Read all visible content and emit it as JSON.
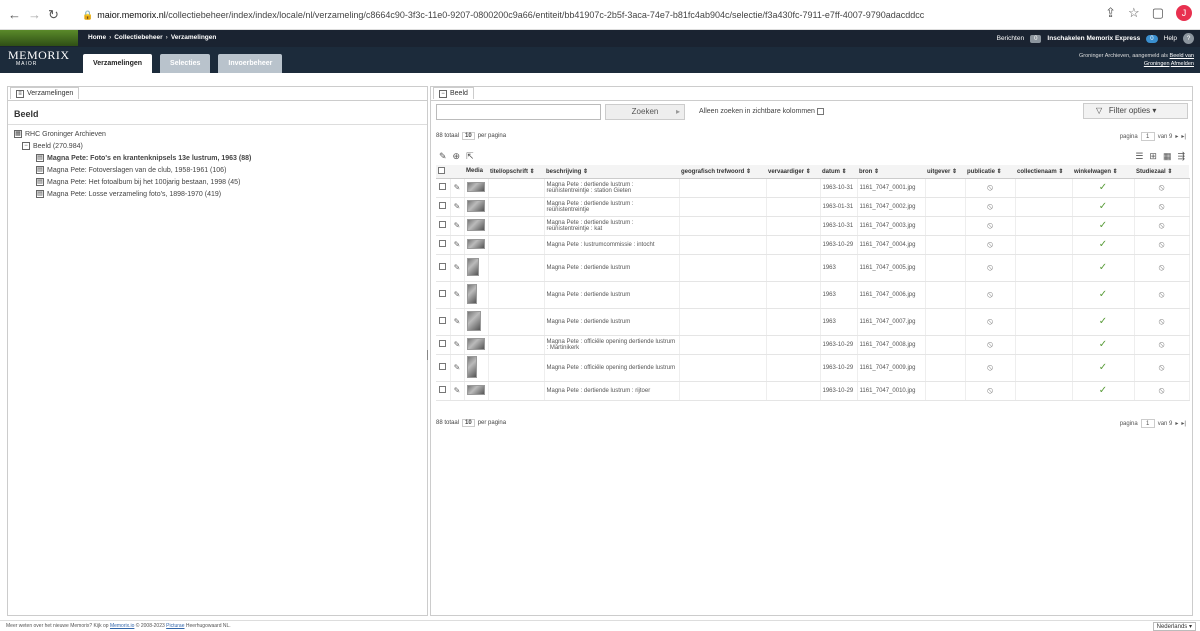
{
  "browser": {
    "url_domain": "maior.memorix.nl",
    "url_path": "/collectiebeheer/index/index/locale/nl/verzameling/c8664c90-3f3c-11e0-9207-0800200c9a66/entiteit/bb41907c-2b5f-3aca-74e7-b81fc4ab904c/selectie/f3a430fc-7911-e7ff-4007-9790adacddcc",
    "profile_initial": "J"
  },
  "header": {
    "logo_text": "MEMORIX",
    "logo_sub": "MAIOR",
    "breadcrumb": [
      "Home",
      "Collectiebeheer",
      "Verzamelingen"
    ],
    "tabs": [
      "Verzamelingen",
      "Selecties",
      "Invoerbeheer"
    ],
    "berichten_label": "Berichten",
    "berichten_count": "0",
    "express_label": "Inschakelen Memorix Express",
    "express_toggle": "0",
    "help_label": "Help",
    "help_icon": "?",
    "login_text": "Groninger Archieven, aangemeld als",
    "login_link": "Beeld van",
    "login_link2": "Groningen",
    "logout_link": "Afmelden"
  },
  "left": {
    "tab_label": "Verzamelingen",
    "title": "Beeld",
    "root": "RHC Groninger Archieven",
    "node": "Beeld (270.984)",
    "items": [
      "Magna Pete: Foto's en krantenknipsels 13e lustrum, 1963 (88)",
      "Magna Pete: Fotoverslagen van de club, 1958-1961 (106)",
      "Magna Pete: Het fotoalbum bij het 100jarig bestaan, 1998 (45)",
      "Magna Pete: Losse verzameling foto's, 1898-1970 (419)"
    ]
  },
  "right": {
    "tab_label": "Beeld",
    "search_button": "Zoeken",
    "visible_only_label": "Alleen zoeken in zichtbare kolommen",
    "filter_label": "Filter opties",
    "total": "88 totaal",
    "per_page_value": "10",
    "per_page_label": "per pagina",
    "page_label": "pagina",
    "page_value": "1",
    "of_label": "van 9",
    "columns": [
      "Media",
      "titel/opschrift ⇕",
      "beschrijving ⇕",
      "geografisch trefwoord ⇕",
      "vervaardiger ⇕",
      "datum ⇕",
      "bron ⇕",
      "uitgever ⇕",
      "publicatie ⇕",
      "collectienaam ⇕",
      "winkelwagen ⇕",
      "Studiezaal ⇕"
    ],
    "rows": [
      {
        "beschrijving": "Magna Pete : dertiende lustrum : reünistentreintje : station Gieten",
        "datum": "1963-10-31",
        "bron": "1161_7047_0001.jpg"
      },
      {
        "beschrijving": "Magna Pete : dertiende lustrum : reünistentreintje",
        "datum": "1963-01-31",
        "bron": "1161_7047_0002.jpg"
      },
      {
        "beschrijving": "Magna Pete : dertiende lustrum : reünistentreintje : kat",
        "datum": "1963-10-31",
        "bron": "1161_7047_0003.jpg"
      },
      {
        "beschrijving": "Magna Pete : lustrumcommissie : intocht",
        "datum": "1963-10-29",
        "bron": "1161_7047_0004.jpg"
      },
      {
        "beschrijving": "Magna Pete : dertiende lustrum",
        "datum": "1963",
        "bron": "1161_7047_0005.jpg"
      },
      {
        "beschrijving": "Magna Pete : dertiende lustrum",
        "datum": "1963",
        "bron": "1161_7047_0006.jpg"
      },
      {
        "beschrijving": "Magna Pete : dertiende lustrum",
        "datum": "1963",
        "bron": "1161_7047_0007.jpg"
      },
      {
        "beschrijving": "Magna Pete : officiële opening dertiende lustrum : Martinikerk",
        "datum": "1963-10-29",
        "bron": "1161_7047_0008.jpg"
      },
      {
        "beschrijving": "Magna Pete : officiële opening dertiende lustrum",
        "datum": "1963-10-29",
        "bron": "1161_7047_0009.jpg"
      },
      {
        "beschrijving": "Magna Pete : dertiende lustrum : rijtoer",
        "datum": "1963-10-29",
        "bron": "1161_7047_0010.jpg"
      }
    ]
  },
  "footer": {
    "text": "Meer weten over het nieuwe Memorix? Kijk op",
    "link1": "Memorix.io",
    "text2": "© 2008-2023",
    "link2": "Picturae",
    "text3": "Heerhugowaard NL.",
    "language": "Nederlands"
  }
}
